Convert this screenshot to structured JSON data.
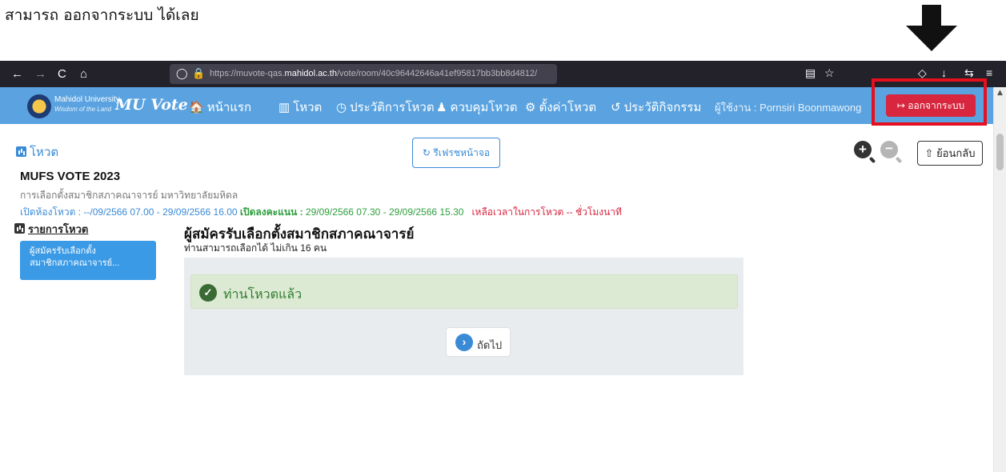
{
  "caption": "สามารถ ออกจากระบบ ได้เลย",
  "browser": {
    "back": "←",
    "forward": "→",
    "reload": "C",
    "home": "⌂",
    "shield": "◯",
    "lock": "🔒",
    "url_prefix": "https://muvote-qas.",
    "url_host": "mahidol.ac.th",
    "url_path": "/vote/room/40c96442646a41ef95817bb3bb8d4812/",
    "reader_icon": "▤",
    "star_icon": "☆",
    "pocket_icon": "◇",
    "download_icon": "↓",
    "extensions_icon": "⇆",
    "menu_icon": "≡"
  },
  "nav": {
    "university": "Mahidol University",
    "university_sub": "Wisdom of the Land",
    "brand": "MU Vote",
    "items": [
      {
        "icon": "🏠",
        "label": "หน้าแรก"
      },
      {
        "icon": "▥",
        "label": "โหวต"
      },
      {
        "icon": "◷",
        "label": "ประวัติการโหวต"
      },
      {
        "icon": "♟",
        "label": "ควบคุมโหวต"
      },
      {
        "icon": "⚙",
        "label": "ตั้งค่าโหวต"
      },
      {
        "icon": "↺",
        "label": "ประวัติกิจกรรม"
      }
    ],
    "user_label": "ผู้ใช้งาน : Pornsiri Boonmawong",
    "logout_icon": "↦",
    "logout_label": "ออกจากระบบ"
  },
  "page": {
    "section_label": "โหวต",
    "refresh_icon": "↻",
    "refresh_label": "รีเฟรชหน้าจอ",
    "zoom_in_label": "+",
    "zoom_out_label": "−",
    "back_icon": "⇧",
    "back_label": "ย้อนกลับ",
    "event_name": "MUFS VOTE 2023",
    "event_sub": "การเลือกตั้งสมาชิกสภาคณาจารย์ มหาวิทยาลัยมหิดล",
    "open_label": "เปิดห้องโหวต :",
    "open_range": "--/09/2566 07.00 - 29/09/2566 16.00",
    "vote_label": "เปิดลงคะแนน :",
    "vote_range": "29/09/2566 07.30 - 29/09/2566 15.30",
    "remaining_label": "เหลือเวลาในการโหวต -- ชั่วโมงนาที",
    "list_heading": "รายการโหวต",
    "side_items": [
      {
        "line1": "ผู้สมัครรับเลือกตั้ง",
        "line2": "สมาชิกสภาคณาจารย์..."
      }
    ],
    "candidate_title": "ผู้สมัครรับเลือกตั้งสมาชิกสภาคณาจารย์",
    "candidate_limit": "ท่านสามารถเลือกได้ ไม่เกิน 16 คน",
    "voted_icon": "✓",
    "voted_text": "ท่านโหวตแล้ว",
    "next_icon": "›",
    "next_label": "ถัดไป"
  },
  "colors": {
    "nav_bg": "#5aa3e0",
    "logout_bg": "#d7263d",
    "highlight": "#e50f1d",
    "accent_blue": "#3a8ad6",
    "success_green": "#2e9e3e"
  }
}
